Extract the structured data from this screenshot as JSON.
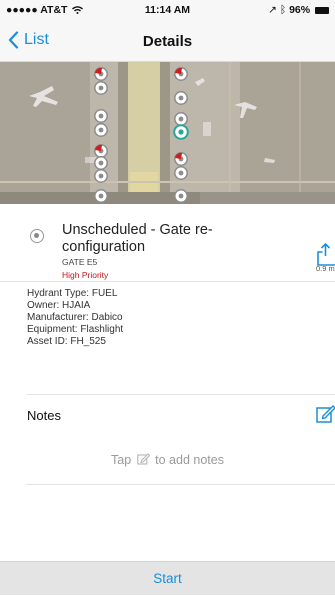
{
  "status_bar": {
    "carrier": "●●●●● AT&T",
    "time": "11:14 AM",
    "battery": "96%"
  },
  "nav": {
    "back_label": "List",
    "title": "Details"
  },
  "asset": {
    "title": "Unscheduled - Gate re-configuration",
    "gate": "GATE E5",
    "priority": "High Priority",
    "distance": "0.9 m"
  },
  "details": {
    "hydrant_type": "Hydrant Type: FUEL",
    "owner": "Owner: HJAIA",
    "manufacturer": "Manufacturer: Dabico",
    "equipment": "Equipment: Flashlight",
    "asset_id": "Asset ID: FH_525"
  },
  "notes": {
    "header": "Notes",
    "hint_before": "Tap",
    "hint_after": "to add notes"
  },
  "footer": {
    "start_label": "Start"
  },
  "colors": {
    "accent": "#1a8fd8",
    "priority": "#c0181f"
  },
  "icons": {
    "back": "chevron-left-icon",
    "share": "share-icon",
    "edit": "edit-icon",
    "pencil": "pencil-icon",
    "marker": "map-pin-icon"
  }
}
